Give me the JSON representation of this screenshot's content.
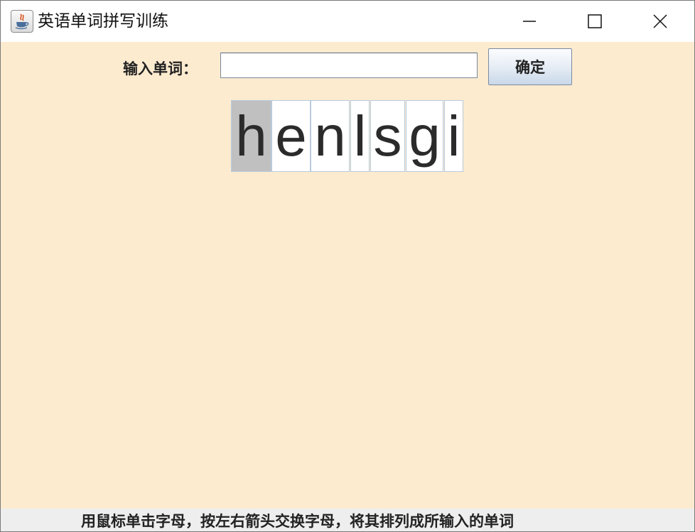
{
  "window": {
    "title": "英语单词拼写训练",
    "icon": "java-cup-icon"
  },
  "controls": {
    "minimize_icon": "minimize-icon",
    "maximize_icon": "maximize-icon",
    "close_icon": "close-icon"
  },
  "form": {
    "label": "输入单词：",
    "input_value": "",
    "button_label": "确定"
  },
  "letters": [
    {
      "char": "h",
      "selected": true
    },
    {
      "char": "e",
      "selected": false
    },
    {
      "char": "n",
      "selected": false
    },
    {
      "char": "l",
      "selected": false
    },
    {
      "char": "s",
      "selected": false
    },
    {
      "char": "g",
      "selected": false
    },
    {
      "char": "i",
      "selected": false
    }
  ],
  "status": {
    "text": "用鼠标单击字母，按左右箭头交换字母，将其排列成所输入的单词"
  },
  "colors": {
    "background": "#fdebd0",
    "selected_letter": "#c0c0c0",
    "letter_border": "#b8cbdc"
  }
}
